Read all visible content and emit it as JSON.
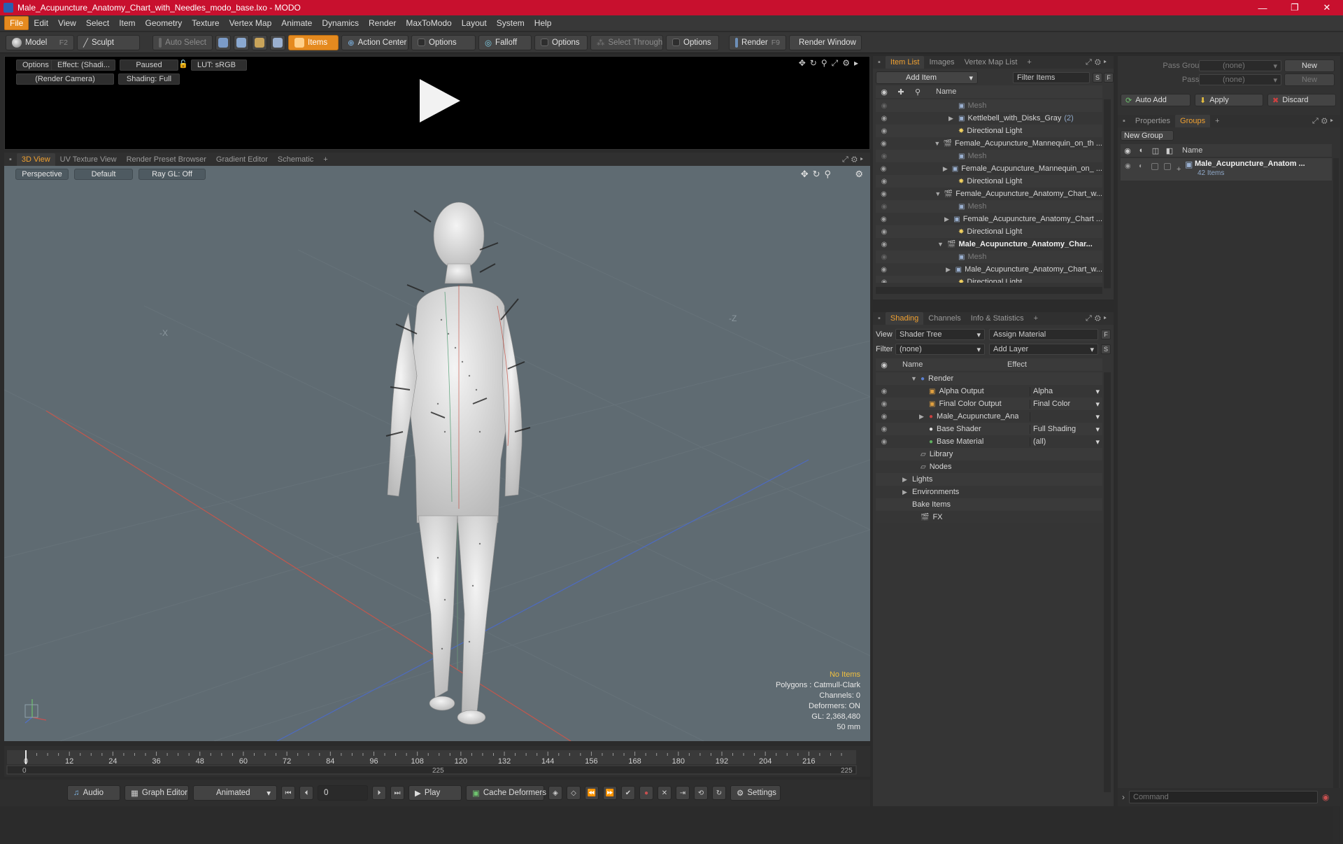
{
  "window": {
    "title": "Male_Acupuncture_Anatomy_Chart_with_Needles_modo_base.lxo - MODO",
    "minimize": "—",
    "restore": "❐",
    "close": "✕"
  },
  "menu": [
    "File",
    "Edit",
    "View",
    "Select",
    "Item",
    "Geometry",
    "Texture",
    "Vertex Map",
    "Animate",
    "Dynamics",
    "Render",
    "MaxToModo",
    "Layout",
    "System",
    "Help"
  ],
  "toolbar": {
    "model": "Model",
    "model_hotkey": "F2",
    "sculpt": "Sculpt",
    "auto_select": "Auto Select",
    "items": "Items",
    "action_center": "Action Center",
    "options1": "Options",
    "falloff": "Falloff",
    "options2": "Options",
    "select_through": "Select Through",
    "options3": "Options",
    "render": "Render",
    "render_hotkey": "F9",
    "render_window": "Render Window"
  },
  "preview": {
    "options": "Options",
    "effect": "Effect: (Shadi...",
    "paused": "Paused",
    "lut": "LUT: sRGB",
    "camera": "(Render Camera)",
    "shading": "Shading: Full"
  },
  "viewport_tabs": [
    "3D View",
    "UV Texture View",
    "Render Preset Browser",
    "Gradient Editor",
    "Schematic",
    "+"
  ],
  "viewport": {
    "perspective": "Perspective",
    "default": "Default",
    "raygl": "Ray GL: Off"
  },
  "stats": {
    "items": "No Items",
    "polygons": "Polygons : Catmull-Clark",
    "channels": "Channels: 0",
    "deformers": "Deformers: ON",
    "gl": "GL: 2,368,480",
    "unit": "50 mm"
  },
  "timeline": {
    "ticks": [
      "0",
      "12",
      "24",
      "36",
      "48",
      "60",
      "72",
      "84",
      "96",
      "108",
      "120",
      "132",
      "144",
      "156",
      "168",
      "180",
      "192",
      "204",
      "216"
    ],
    "start": "0",
    "mid": "225",
    "end": "225"
  },
  "bottom": {
    "audio": "Audio",
    "graph_editor": "Graph Editor",
    "animated": "Animated",
    "frame": "0",
    "play": "Play",
    "cache": "Cache Deformers",
    "settings": "Settings"
  },
  "itemlist": {
    "tabs": [
      "Item List",
      "Images",
      "Vertex Map List",
      "+"
    ],
    "add_item": "Add Item",
    "filter_items": "Filter Items",
    "s": "S",
    "f": "F",
    "col_name": "Name",
    "rows": [
      {
        "label": "Mesh",
        "indent": 2,
        "style": "gray",
        "arrow": ""
      },
      {
        "label": "Kettlebell_with_Disks_Gray",
        "count": "(2)",
        "indent": 2,
        "style": "",
        "arrow": "▶"
      },
      {
        "label": "Directional Light",
        "indent": 2,
        "style": "",
        "arrow": ""
      },
      {
        "label": "Female_Acupuncture_Mannequin_on_th ...",
        "indent": 1,
        "style": "",
        "arrow": "▼"
      },
      {
        "label": "Mesh",
        "indent": 2,
        "style": "gray",
        "arrow": ""
      },
      {
        "label": "Female_Acupuncture_Mannequin_on_ ...",
        "indent": 2,
        "style": "",
        "arrow": "▶"
      },
      {
        "label": "Directional Light",
        "indent": 2,
        "style": "",
        "arrow": ""
      },
      {
        "label": "Female_Acupuncture_Anatomy_Chart_w...",
        "indent": 1,
        "style": "",
        "arrow": "▼"
      },
      {
        "label": "Mesh",
        "indent": 2,
        "style": "gray",
        "arrow": ""
      },
      {
        "label": "Female_Acupuncture_Anatomy_Chart ...",
        "indent": 2,
        "style": "",
        "arrow": "▶"
      },
      {
        "label": "Directional Light",
        "indent": 2,
        "style": "",
        "arrow": ""
      },
      {
        "label": "Male_Acupuncture_Anatomy_Char...",
        "indent": 1,
        "style": "bold",
        "arrow": "▼"
      },
      {
        "label": "Mesh",
        "indent": 2,
        "style": "gray",
        "arrow": ""
      },
      {
        "label": "Male_Acupuncture_Anatomy_Chart_w...",
        "indent": 2,
        "style": "",
        "arrow": "▶"
      },
      {
        "label": "Directional Light",
        "indent": 2,
        "style": "",
        "arrow": ""
      }
    ]
  },
  "shading": {
    "tabs": [
      "Shading",
      "Channels",
      "Info & Statistics",
      "+"
    ],
    "view_label": "View",
    "view_value": "Shader Tree",
    "assign_material": "Assign Material",
    "filter_label": "Filter",
    "filter_value": "(none)",
    "add_layer": "Add Layer",
    "col_name": "Name",
    "col_effect": "Effect",
    "rows": [
      {
        "label": "Render",
        "effect": "",
        "indent": 0,
        "arrow": "▼",
        "icon": "render",
        "eye": false
      },
      {
        "label": "Alpha Output",
        "effect": "Alpha",
        "indent": 1,
        "arrow": "",
        "icon": "output",
        "eye": true
      },
      {
        "label": "Final Color Output",
        "effect": "Final Color",
        "indent": 1,
        "arrow": "",
        "icon": "output",
        "eye": true
      },
      {
        "label": "Male_Acupuncture_Anato ...",
        "effect": "",
        "indent": 1,
        "arrow": "▶",
        "icon": "material",
        "eye": true
      },
      {
        "label": "Base Shader",
        "effect": "Full Shading",
        "indent": 1,
        "arrow": "",
        "icon": "shader",
        "eye": true
      },
      {
        "label": "Base Material",
        "effect": "(all)",
        "indent": 1,
        "arrow": "",
        "icon": "basemat",
        "eye": true
      },
      {
        "label": "Library",
        "effect": "",
        "indent": 0,
        "arrow": "",
        "icon": "folder",
        "eye": false
      },
      {
        "label": "Nodes",
        "effect": "",
        "indent": 0,
        "arrow": "",
        "icon": "folder",
        "eye": false
      },
      {
        "label": "Lights",
        "effect": "",
        "indent": -1,
        "arrow": "▶",
        "icon": "",
        "eye": false
      },
      {
        "label": "Environments",
        "effect": "",
        "indent": -1,
        "arrow": "▶",
        "icon": "",
        "eye": false
      },
      {
        "label": "Bake Items",
        "effect": "",
        "indent": -1,
        "arrow": "",
        "icon": "",
        "eye": false
      },
      {
        "label": "FX",
        "effect": "",
        "indent": 0,
        "arrow": "",
        "icon": "fx",
        "eye": false
      }
    ]
  },
  "groups": {
    "pass_groups_label": "Pass Groups",
    "pass_groups_value": "(none)",
    "passes_label": "Passes",
    "passes_value": "(none)",
    "new1": "New",
    "new2": "New",
    "auto_add": "Auto Add",
    "apply": "Apply",
    "discard": "Discard",
    "tabs": [
      "Properties",
      "Groups",
      "+"
    ],
    "new_group": "New Group",
    "col_name": "Name",
    "group_name": "Male_Acupuncture_Anatom ...",
    "group_count": "42 Items"
  },
  "command": {
    "placeholder": "Command"
  },
  "colors": {
    "accent": "#e58a1f",
    "titlebar": "#c8102e",
    "viewport": "#5f6b72"
  }
}
